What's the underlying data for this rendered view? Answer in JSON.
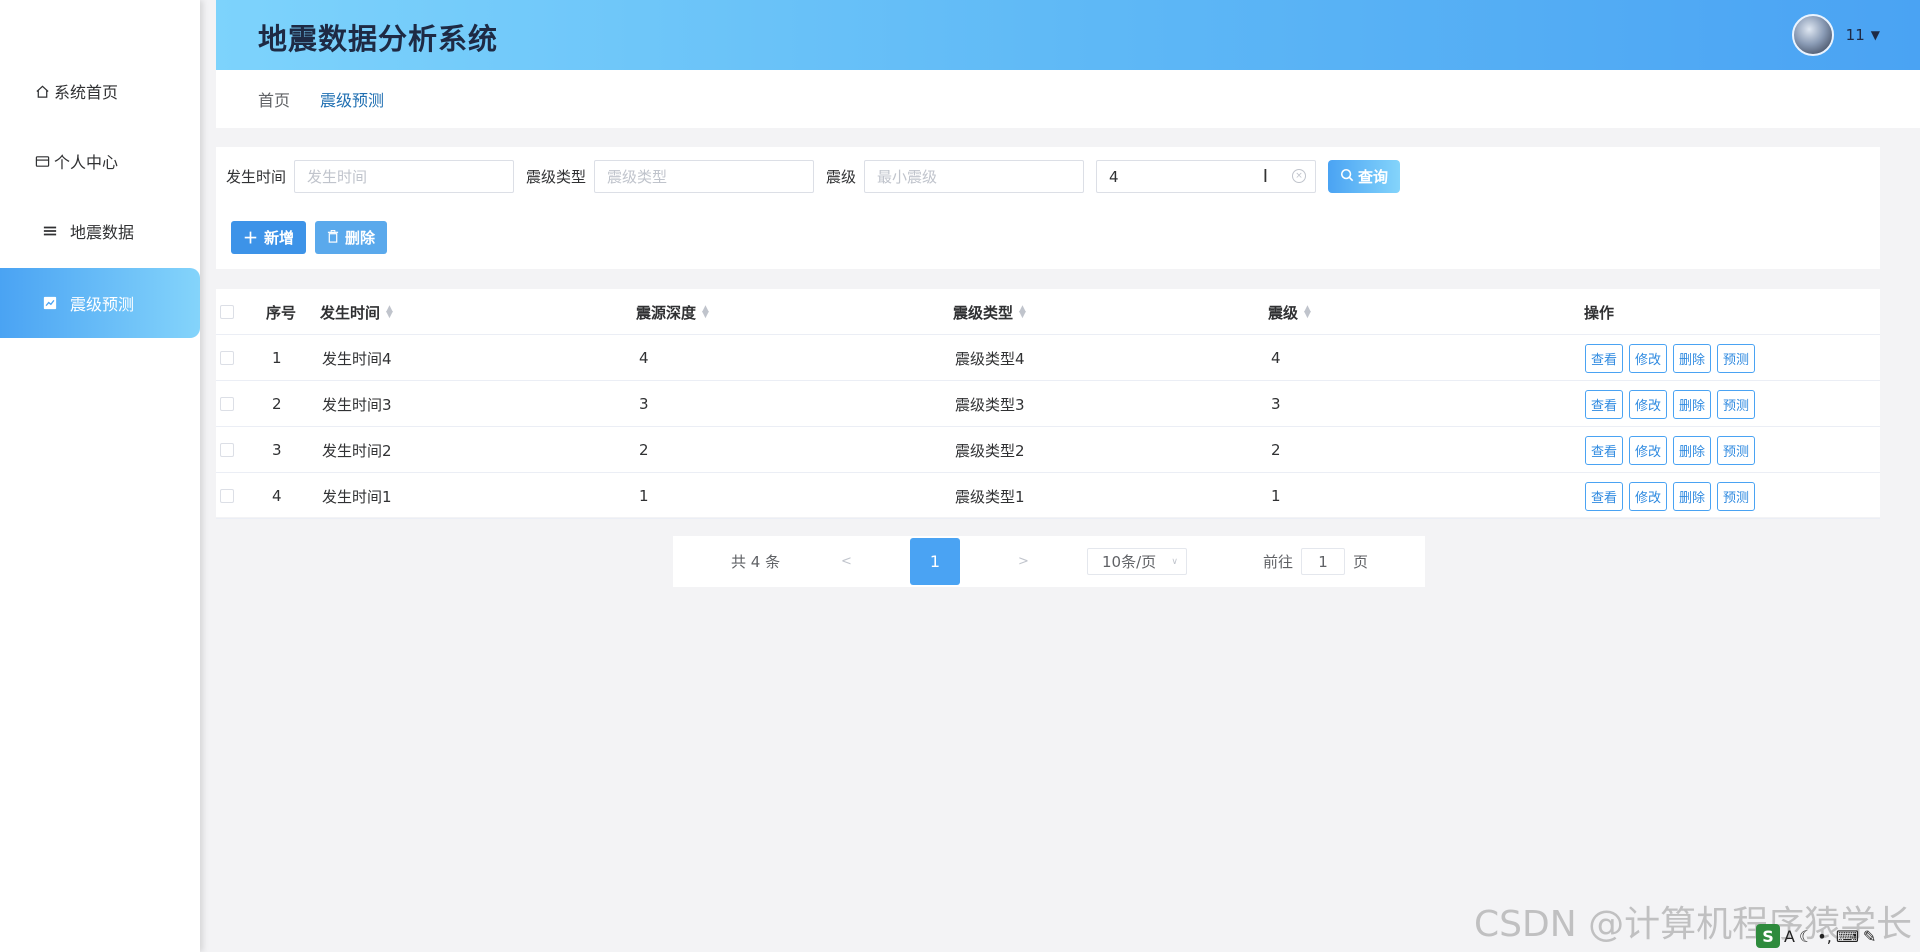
{
  "header": {
    "title": "地震数据分析系统",
    "username": "11",
    "caret": "▼"
  },
  "sidebar": {
    "items": [
      {
        "label": "系统首页",
        "icon": "home-icon"
      },
      {
        "label": "个人中心",
        "icon": "card-icon"
      },
      {
        "label": "地震数据",
        "icon": "list-icon"
      },
      {
        "label": "震级预测",
        "icon": "chart-icon",
        "active": true
      }
    ]
  },
  "breadcrumb": {
    "home": "首页",
    "current": "震级预测"
  },
  "search": {
    "time_label": "发生时间",
    "time_placeholder": "发生时间",
    "type_label": "震级类型",
    "type_placeholder": "震级类型",
    "mag_label": "震级",
    "mag_min_placeholder": "最小震级",
    "mag_max_value": "4",
    "query_label": "查询"
  },
  "actions": {
    "add_label": "新增",
    "delete_label": "删除"
  },
  "table": {
    "headers": {
      "index": "序号",
      "time": "发生时间",
      "depth": "震源深度",
      "type": "震级类型",
      "magnitude": "震级",
      "ops": "操作"
    },
    "ops_labels": {
      "view": "查看",
      "edit": "修改",
      "delete": "删除",
      "predict": "预测"
    },
    "rows": [
      {
        "index": "1",
        "time": "发生时间4",
        "depth": "4",
        "type": "震级类型4",
        "magnitude": "4"
      },
      {
        "index": "2",
        "time": "发生时间3",
        "depth": "3",
        "type": "震级类型3",
        "magnitude": "3"
      },
      {
        "index": "3",
        "time": "发生时间2",
        "depth": "2",
        "type": "震级类型2",
        "magnitude": "2"
      },
      {
        "index": "4",
        "time": "发生时间1",
        "depth": "1",
        "type": "震级类型1",
        "magnitude": "1"
      }
    ]
  },
  "pagination": {
    "total_text": "共 4 条",
    "prev": "<",
    "current_page": "1",
    "next": ">",
    "page_size": "10条/页",
    "goto_prefix": "前往",
    "goto_value": "1",
    "goto_suffix": "页"
  },
  "watermark": "CSDN @计算机程序猿学长",
  "colors": {
    "accent": "#4aa3f3",
    "accent_light": "#84d4fb",
    "header_text": "#1e2a44"
  }
}
